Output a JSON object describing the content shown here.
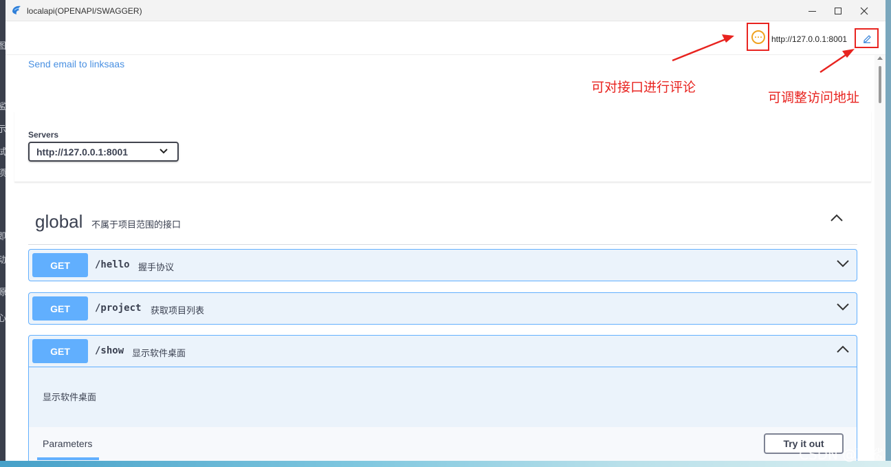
{
  "window": {
    "title": "localapi(OPENAPI/SWAGGER)"
  },
  "background_chars": [
    "图",
    "鲨",
    "示",
    "试",
    "项",
    "即",
    "动",
    "源",
    "心"
  ],
  "toolbar": {
    "server_url": "http://127.0.0.1:8001"
  },
  "info": {
    "email_link": "Send email to linksaas"
  },
  "servers": {
    "label": "Servers",
    "selected": "http://127.0.0.1:8001"
  },
  "tag": {
    "name": "global",
    "description": "不属于项目范围的接口"
  },
  "operations": [
    {
      "method": "GET",
      "path": "/hello",
      "summary": "握手协议",
      "expanded": false
    },
    {
      "method": "GET",
      "path": "/project",
      "summary": "获取项目列表",
      "expanded": false
    },
    {
      "method": "GET",
      "path": "/show",
      "summary": "显示软件桌面",
      "expanded": true,
      "description": "显示软件桌面"
    }
  ],
  "params": {
    "label": "Parameters",
    "try_button": "Try it out"
  },
  "annotations": {
    "comment": "可对接口进行评论",
    "address": "可调整访问地址"
  },
  "watermark": "CSDN @凌鲨",
  "colors": {
    "get_method": "#61affe",
    "annotation_red": "#e8231f",
    "comment_icon": "#f0a21f",
    "link": "#4990e2"
  }
}
